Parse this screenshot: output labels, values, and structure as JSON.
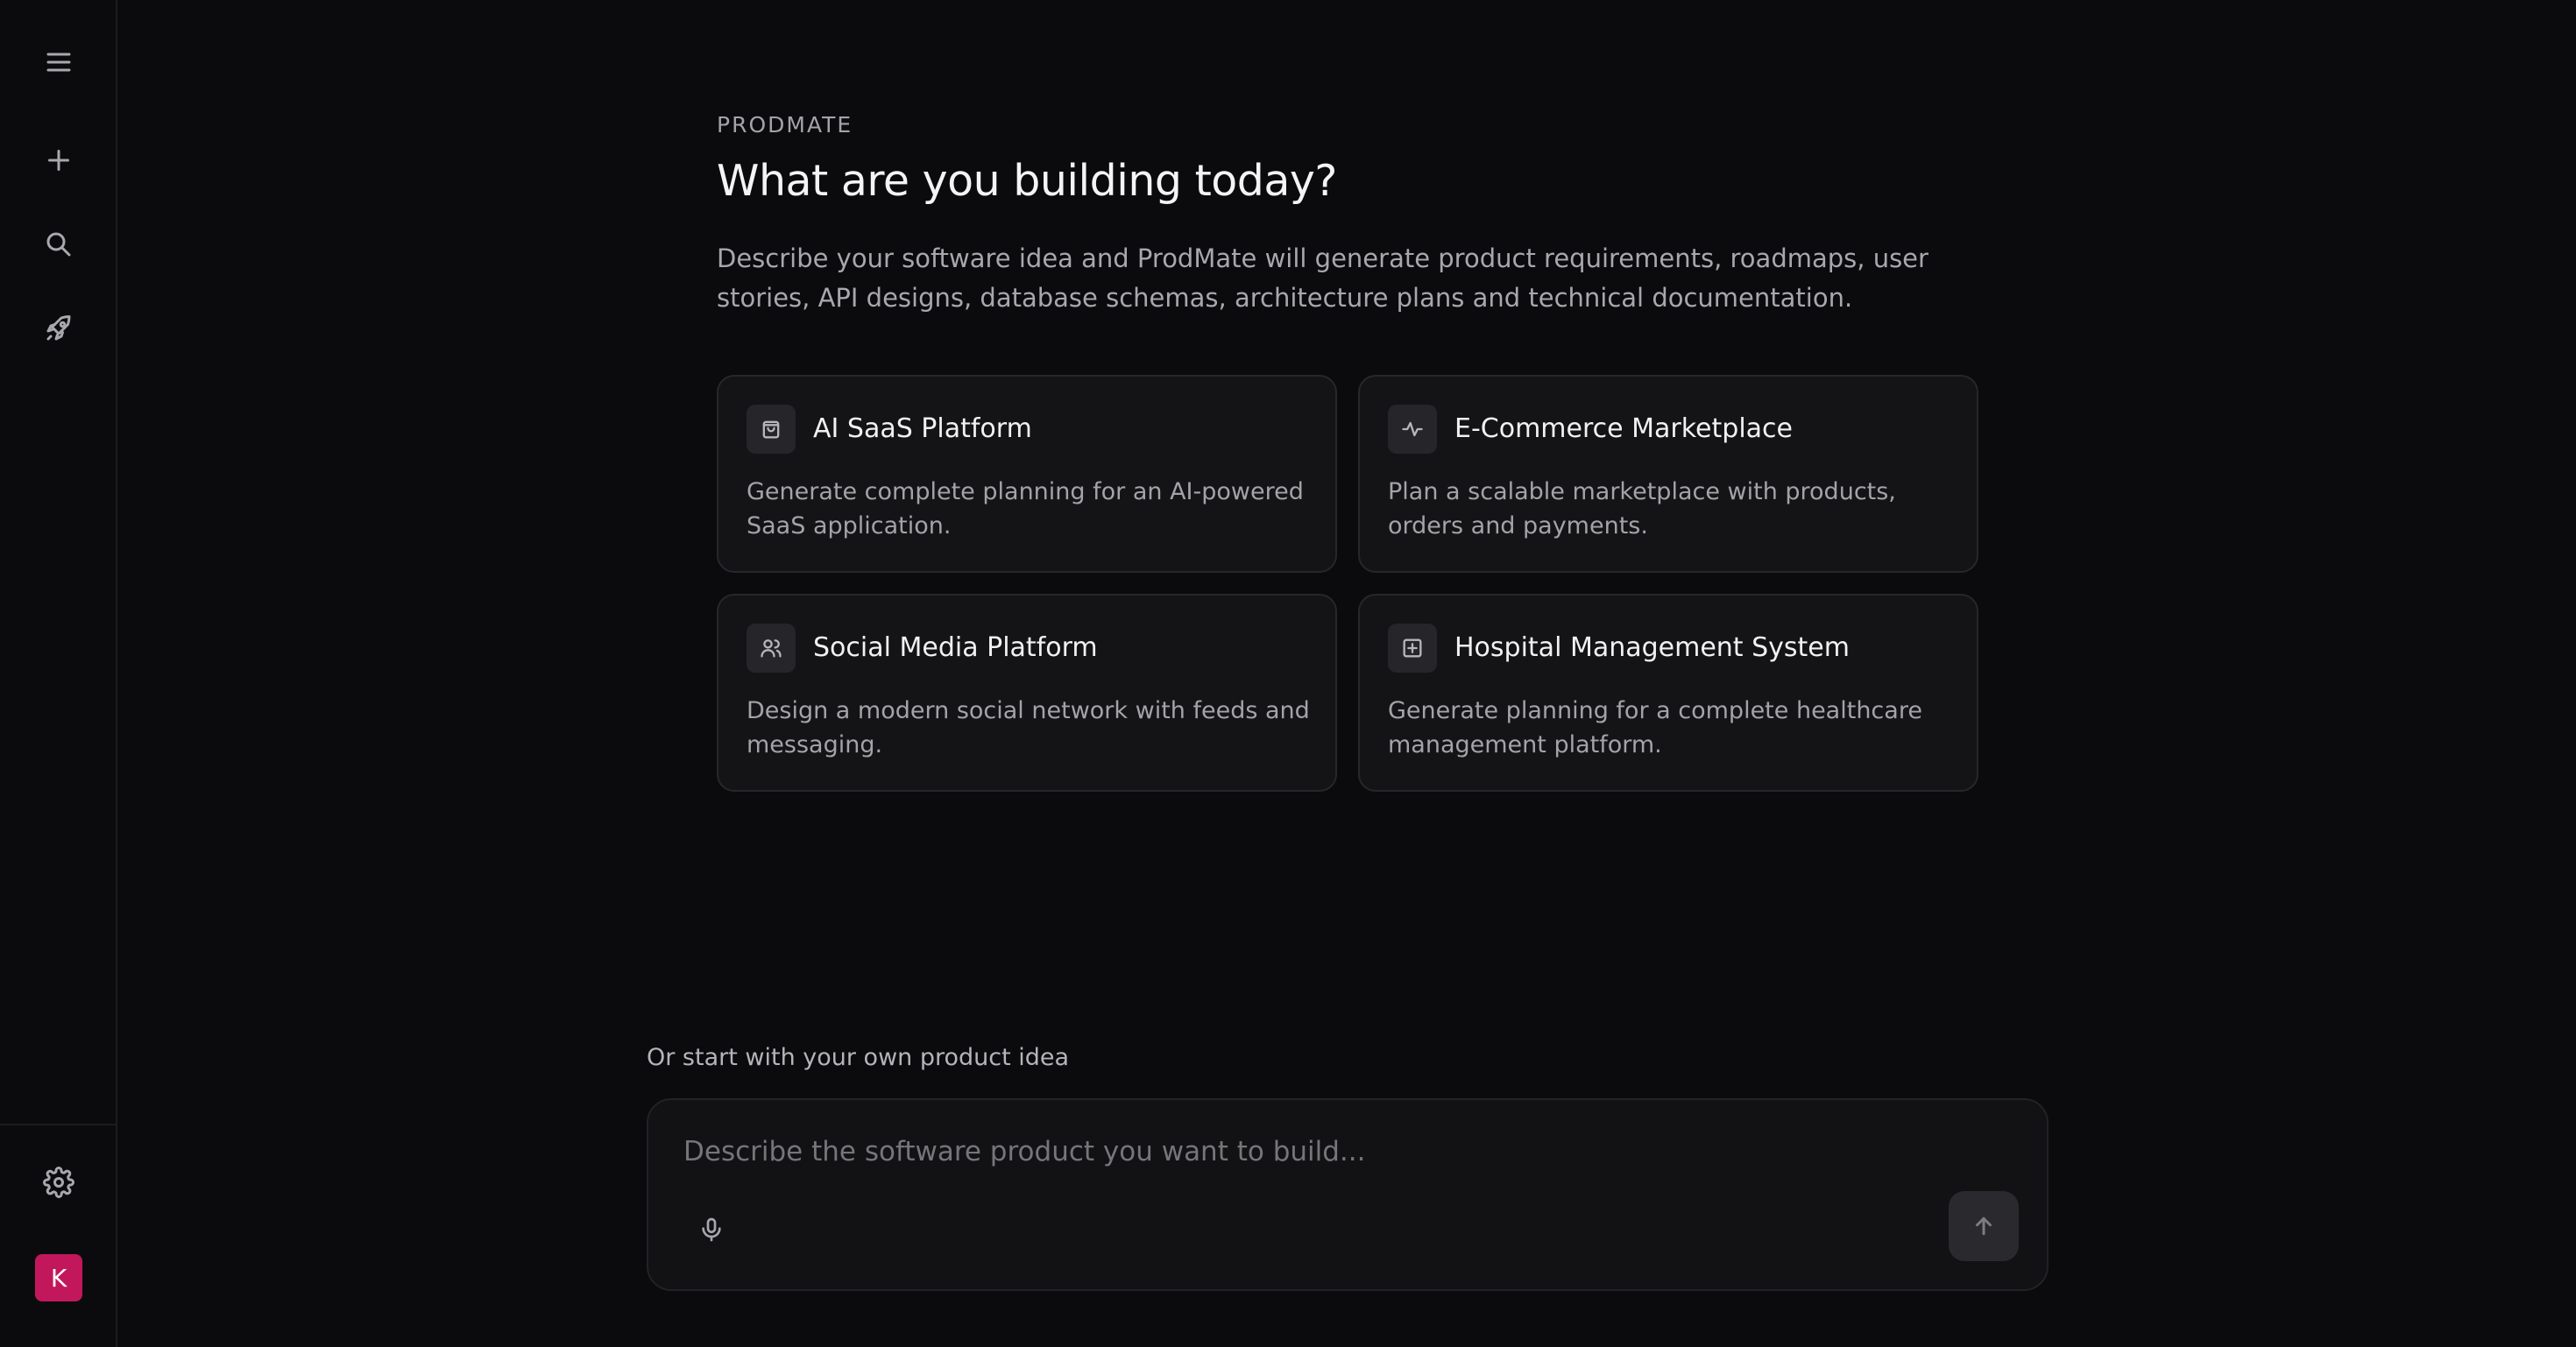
{
  "sidebar": {
    "items": [
      {
        "name": "menu",
        "icon": "menu-icon"
      },
      {
        "name": "new-chat",
        "icon": "plus-icon"
      },
      {
        "name": "search",
        "icon": "search-icon"
      },
      {
        "name": "rocket",
        "icon": "rocket-icon"
      },
      {
        "name": "settings",
        "icon": "gear-icon"
      }
    ],
    "avatar": {
      "initial": "K",
      "color": "#c2185b"
    }
  },
  "hero": {
    "brand": "PRODMATE",
    "title": "What are you building today?",
    "subtitle": "Describe your software idea and ProdMate will generate product requirements, roadmaps, user stories, API designs, database schemas, architecture plans and technical documentation."
  },
  "templates": [
    {
      "title": "AI SaaS Platform",
      "description": "Generate complete planning for an AI-powered SaaS application.",
      "icon": "shopping-bag-icon"
    },
    {
      "title": "E-Commerce Marketplace",
      "description": "Plan a scalable marketplace with products, orders and payments.",
      "icon": "activity-icon"
    },
    {
      "title": "Social Media Platform",
      "description": "Design a modern social network with feeds and messaging.",
      "icon": "users-icon"
    },
    {
      "title": "Hospital Management System",
      "description": "Generate planning for a complete healthcare management platform.",
      "icon": "plus-square-icon"
    }
  ],
  "composer": {
    "label": "Or start with your own product idea",
    "placeholder": "Describe the software product you want to build..."
  },
  "colors": {
    "background": "#0b0b0d",
    "card": "#141416",
    "avatar": "#c2185b"
  }
}
